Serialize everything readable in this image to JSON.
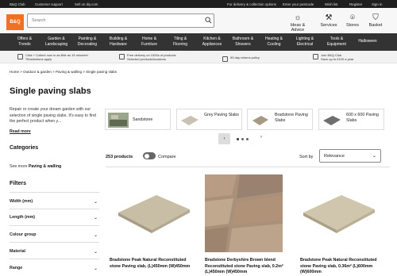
{
  "topbar": {
    "links": [
      "B&Q Club",
      "Customer support",
      "Sell on diy.com"
    ],
    "delivery": "For delivery & collection options",
    "postcode": "Enter your postcode",
    "wishlist": "Wish list",
    "register": "Register",
    "sign_in": "Sign in"
  },
  "header": {
    "logo": "B&Q",
    "search_placeholder": "Search",
    "icons": [
      {
        "label": "Ideas & Advice",
        "icon": "lightbulb-icon"
      },
      {
        "label": "Services",
        "icon": "wrench-icon"
      },
      {
        "label": "Stores",
        "icon": "pin-icon"
      },
      {
        "label": "Basket",
        "icon": "basket-icon"
      }
    ]
  },
  "nav": [
    [
      "Offers &",
      "Trends"
    ],
    [
      "Garden &",
      "Landscaping"
    ],
    [
      "Painting &",
      "Decorating"
    ],
    [
      "Building &",
      "Hardware"
    ],
    [
      "Home &",
      "Furniture"
    ],
    [
      "Tiling &",
      "Flooring"
    ],
    [
      "Kitchen &",
      "Appliances"
    ],
    [
      "Bathroom &",
      "Showers"
    ],
    [
      "Heating &",
      "Cooling"
    ],
    [
      "Lighting &",
      "Electrical"
    ],
    [
      "Tools &",
      "Equipment"
    ],
    [
      "Halloween",
      ""
    ]
  ],
  "promo": [
    [
      "Click + Collect now in as little as 15 minutes*",
      "*Restrictions apply"
    ],
    [
      "Free delivery on 1000s of products",
      "Selected products/locations"
    ],
    [
      "90 day returns policy",
      ""
    ],
    [
      "Join B&Q Club",
      "Save up to £100 a year"
    ]
  ],
  "breadcrumb": "Home > Outdoor & garden > Paving & walling > Single paving slabs",
  "page_title": "Single paving slabs",
  "intro": "Repair or create your dream garden with our selection of single paving slabs. It's easy to find the perfect product when y...",
  "read_more": "Read more",
  "categories_heading": "Categories",
  "see_more_prefix": "See more ",
  "see_more_link": "Paving & walling",
  "filters_heading": "Filters",
  "filters": [
    "Width (mm)",
    "Length (mm)",
    "Colour group",
    "Material",
    "Range"
  ],
  "category_cards": [
    "Sandstone",
    "Grey Paving Slabs",
    "Bradstone Paving Slabs",
    "600 x 600 Paving Slabs"
  ],
  "product_count": "253 products",
  "compare_label": "Compare",
  "sort_label": "Sort by",
  "sort_value": "Relevance",
  "products": [
    "Bradstone Peak Natural Reconstituted stone Paving slab, (L)450mm (W)450mm",
    "Bradstone Derbyshire Brown blend Reconstituted stone Paving slab, 0.2m² (L)450mm (W)450mm",
    "Bradstone Peak Natural Reconstituted stone Paving slab, 0.36m² (L)600mm (W)600mm"
  ],
  "colors": {
    "brand": "#f36f21",
    "nav": "#333333",
    "topbar": "#1e1e1e"
  }
}
